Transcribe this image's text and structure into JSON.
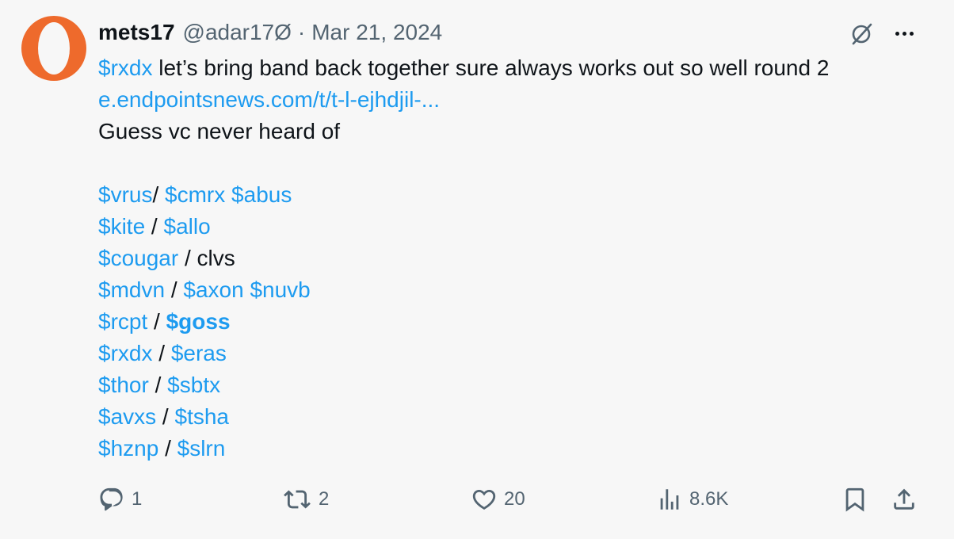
{
  "tweet": {
    "display_name": "mets17",
    "handle": "@adar17Ø",
    "separator": "·",
    "date": "Mar 21, 2024",
    "line1": {
      "cashtag": "$rxdx",
      "text": " let’s bring band back together sure always works out so well round 2"
    },
    "link": "e.endpointsnews.com/t/t-l-ejhdjil-...",
    "line3": "Guess vc never heard of",
    "pairs": [
      {
        "left": "$vrus",
        "sep": "/ ",
        "right": "$cmrx",
        "extra": " $abus"
      },
      {
        "left": "$kite",
        "sep": " / ",
        "right": "$allo"
      },
      {
        "left": "$cougar",
        "sep": " / ",
        "right_plain": "clvs"
      },
      {
        "left": "$mdvn",
        "sep": " / ",
        "right": "$axon",
        "extra": " $nuvb"
      },
      {
        "left": "$rcpt",
        "sep": " / ",
        "right_bold": "$goss"
      },
      {
        "left": "$rxdx",
        "sep": " / ",
        "right": "$eras"
      },
      {
        "left": "$thor",
        "sep": " / ",
        "right": "$sbtx"
      },
      {
        "left": "$avxs",
        "sep": " / ",
        "right": "$tsha"
      },
      {
        "left": "$hznp",
        "sep": " / ",
        "right": "$slrn"
      }
    ]
  },
  "actions": {
    "reply_count": "1",
    "retweet_count": "2",
    "like_count": "20",
    "views_count": "8.6K"
  },
  "colors": {
    "accent": "#1d9bf0",
    "text": "#0f1419",
    "muted": "#536471",
    "avatar": "#ee6a2c",
    "background": "#f7f7f7"
  },
  "icons": [
    "grok-icon",
    "more-icon",
    "reply-icon",
    "retweet-icon",
    "like-icon",
    "views-icon",
    "bookmark-icon",
    "share-icon"
  ]
}
